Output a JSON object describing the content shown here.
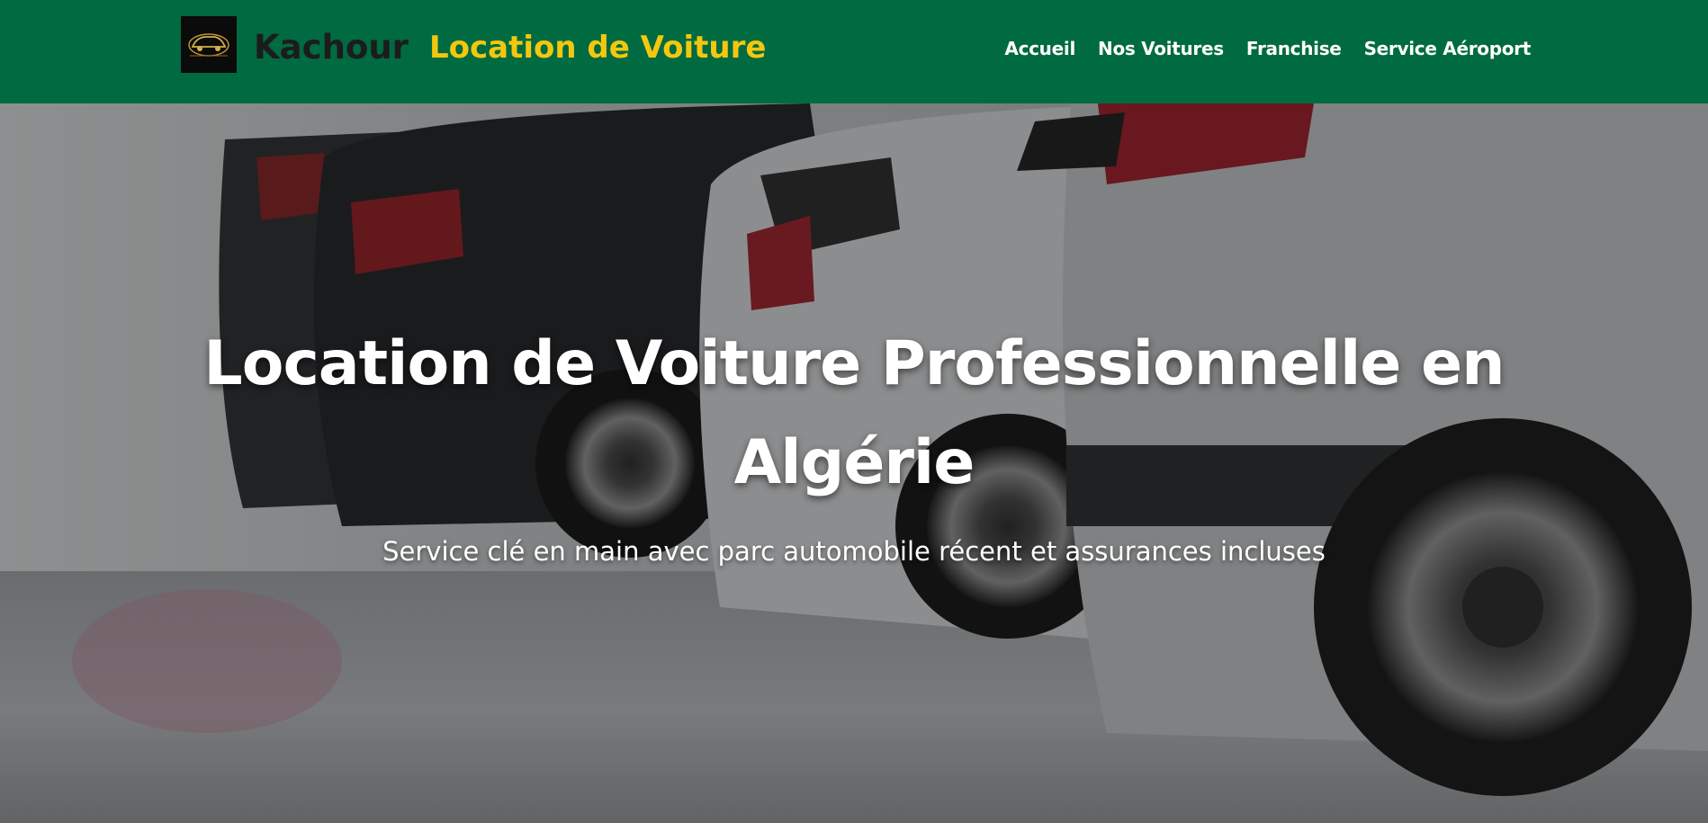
{
  "header": {
    "brand_name": "Kachour",
    "brand_tagline": "Location de Voiture",
    "colors": {
      "background": "#006a41",
      "brand_name": "#1c1c1c",
      "tagline": "#f4c70f",
      "nav_text": "#ffffff"
    },
    "nav": [
      {
        "label": "Accueil"
      },
      {
        "label": "Nos Voitures"
      },
      {
        "label": "Franchise"
      },
      {
        "label": "Service Aéroport"
      }
    ]
  },
  "hero": {
    "title": "Location de Voiture Professionnelle en Algérie",
    "subtitle": "Service clé en main avec parc automobile récent et assurances incluses",
    "background_image": "row-of-parked-cars-photo"
  }
}
